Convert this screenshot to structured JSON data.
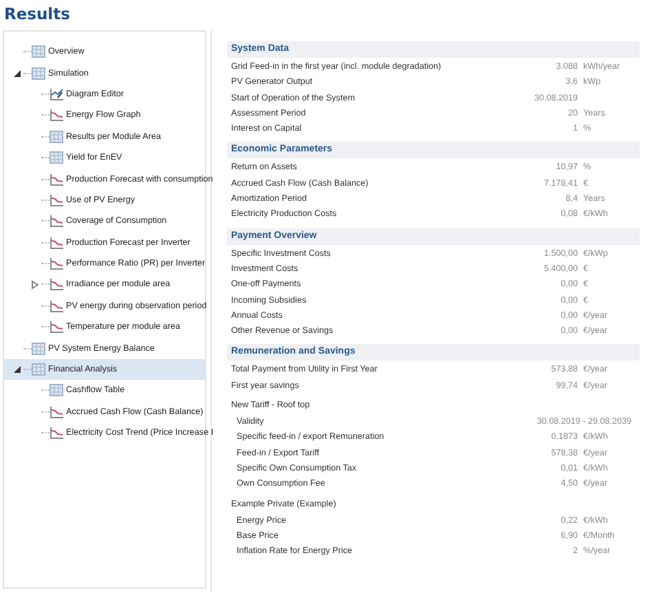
{
  "title": "Results",
  "tree": [
    {
      "label": "Overview",
      "kind": "table",
      "selected": false
    },
    {
      "label": "Simulation",
      "kind": "table",
      "selected": false,
      "expanded": true,
      "children": [
        {
          "label": "Diagram Editor",
          "kind": "editor",
          "selected": false
        },
        {
          "label": "Energy Flow Graph",
          "kind": "chart",
          "selected": false
        },
        {
          "label": "Results per Module Area",
          "kind": "table",
          "selected": false
        },
        {
          "label": "Yield for EnEV",
          "kind": "table",
          "selected": false
        },
        {
          "label": "Production Forecast with consumption",
          "kind": "chart",
          "selected": false
        },
        {
          "label": "Use of PV Energy",
          "kind": "chart",
          "selected": false
        },
        {
          "label": "Coverage of Consumption",
          "kind": "chart",
          "selected": false
        },
        {
          "label": "Production Forecast per Inverter",
          "kind": "chart",
          "selected": false
        },
        {
          "label": "Performance Ratio (PR) per Inverter",
          "kind": "chart",
          "selected": false
        },
        {
          "label": "Irradiance per module area",
          "kind": "chart",
          "selected": false,
          "expanded": false
        },
        {
          "label": "PV energy during observation period",
          "kind": "chart",
          "selected": false
        },
        {
          "label": "Temperature per module area",
          "kind": "chart",
          "selected": false
        }
      ]
    },
    {
      "label": "PV System Energy Balance",
      "kind": "table",
      "selected": false
    },
    {
      "label": "Financial Analysis",
      "kind": "table",
      "selected": true,
      "expanded": true,
      "children": [
        {
          "label": "Cashflow Table",
          "kind": "table",
          "selected": false
        },
        {
          "label": "Accrued Cash Flow (Cash Balance)",
          "kind": "chart",
          "selected": false
        },
        {
          "label": "Electricity Cost Trend (Price Increase I",
          "kind": "chart",
          "selected": false
        }
      ]
    }
  ],
  "sections": [
    {
      "kind": "header",
      "title": "System Data",
      "rows": [
        {
          "kind": "value",
          "label": "Grid Feed-in in the first year (incl. module degradation)",
          "value": "3.088",
          "unit": "kWh/year"
        },
        {
          "kind": "value",
          "label": "PV Generator Output",
          "value": "3,6",
          "unit": "kWp"
        },
        {
          "kind": "value",
          "label": "Start of Operation of the System",
          "value": "30.08.2019"
        },
        {
          "kind": "value",
          "label": "Assessment Period",
          "value": "20",
          "unit": "Years"
        },
        {
          "kind": "value",
          "label": "Interest on Capital",
          "value": "1",
          "unit": "%"
        }
      ]
    },
    {
      "kind": "header",
      "title": "Economic Parameters",
      "rows": [
        {
          "kind": "value",
          "label": "Return on Assets",
          "value": "10,97",
          "unit": "%"
        },
        {
          "kind": "value",
          "label": "Accrued Cash Flow (Cash Balance)",
          "value": "7.178,41",
          "unit": "€"
        },
        {
          "kind": "value",
          "label": "Amortization Period",
          "value": "8,4",
          "unit": "Years"
        },
        {
          "kind": "value",
          "label": "Electricity Production Costs",
          "value": "0,08",
          "unit": "€/kWh"
        }
      ]
    },
    {
      "kind": "header",
      "title": "Payment Overview",
      "rows": [
        {
          "kind": "value",
          "label": "Specific Investment Costs",
          "value": "1.500,00",
          "unit": "€/kWp"
        },
        {
          "kind": "value",
          "label": "Investment Costs",
          "value": "5.400,00",
          "unit": "€"
        },
        {
          "kind": "value",
          "label": "One-off Payments",
          "value": "0,00",
          "unit": "€"
        },
        {
          "kind": "value",
          "label": "Incoming Subsidies",
          "value": "0,00",
          "unit": "€"
        },
        {
          "kind": "value",
          "label": "Annual Costs",
          "value": "0,00",
          "unit": "€/year"
        },
        {
          "kind": "value",
          "label": "Other Revenue or Savings",
          "value": "0,00",
          "unit": "€/year"
        }
      ]
    },
    {
      "kind": "header",
      "title": "Remuneration and Savings",
      "rows": [
        {
          "kind": "value",
          "label": "Total Payment from Utility in First Year",
          "value": "573,88",
          "unit": "€/year"
        },
        {
          "kind": "value",
          "label": "First year savings",
          "value": "99,74",
          "unit": "€/year"
        }
      ]
    },
    {
      "kind": "group",
      "title": "New Tariff - Roof top",
      "rows": [
        {
          "kind": "range",
          "label": "Validity",
          "value": "30.08.2019 - 29.08.2039"
        },
        {
          "kind": "value",
          "label": "Specific feed-in / export Remuneration",
          "value": "0,1873",
          "unit": "€/kWh"
        },
        {
          "kind": "value",
          "label": "Feed-in / Export Tariff",
          "value": "578,38",
          "unit": "€/year"
        },
        {
          "kind": "value",
          "label": "Specific Own Consumption Tax",
          "value": "0,01",
          "unit": "€/kWh"
        },
        {
          "kind": "value",
          "label": "Own Consumption Fee",
          "value": "4,50",
          "unit": "€/year"
        }
      ]
    },
    {
      "kind": "group",
      "title": "Example Private (Example)",
      "rows": [
        {
          "kind": "value",
          "label": "Energy Price",
          "value": "0,22",
          "unit": "€/kWh"
        },
        {
          "kind": "value",
          "label": "Base Price",
          "value": "6,90",
          "unit": "€/Month"
        },
        {
          "kind": "value",
          "label": "Inflation Rate for Energy Price",
          "value": "2",
          "unit": "%/year"
        }
      ]
    }
  ]
}
